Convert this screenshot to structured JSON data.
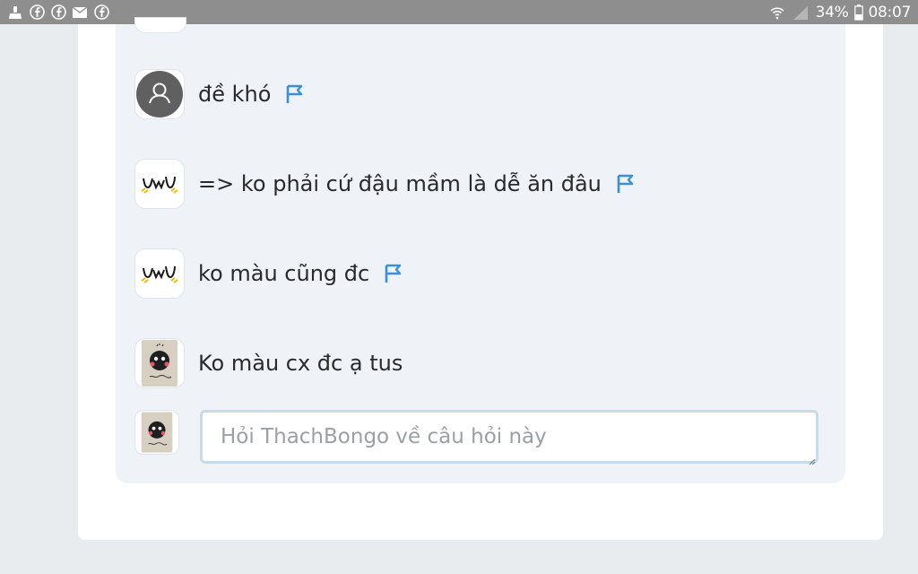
{
  "status_bar": {
    "icons_left": [
      "cleaner-icon",
      "facebook-icon",
      "facebook-icon",
      "mail-icon",
      "facebook-icon"
    ],
    "battery": "34%",
    "time": "08:07"
  },
  "comments": [
    {
      "avatar": "default-user-avatar",
      "text": "đề khó",
      "flagged": true
    },
    {
      "avatar": "uwu-avatar",
      "text": "=> ko phải cứ đậu mầm là dễ ăn đâu",
      "flagged": true
    },
    {
      "avatar": "uwu-avatar",
      "text": "ko màu cũng đc",
      "flagged": true
    },
    {
      "avatar": "kameko-photo-avatar",
      "text": "Ko màu cx đc ạ tus",
      "flagged": false
    }
  ],
  "reply_box": {
    "placeholder": "Hỏi ThachBongo về câu hỏi này",
    "value": ""
  },
  "colors": {
    "status_bar": "#8e8e8e",
    "panel_bg": "#eff3f8",
    "flag_blue": "#3a8fd9",
    "input_border": "#c7dce8"
  }
}
